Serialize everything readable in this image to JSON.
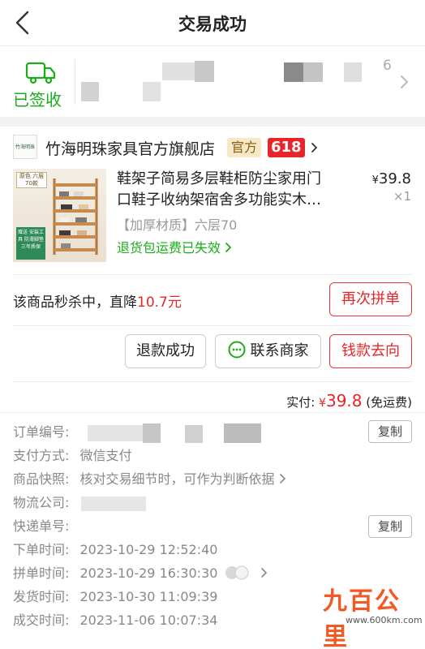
{
  "nav": {
    "title": "交易成功"
  },
  "logistics": {
    "status": "已签收",
    "digit": "6"
  },
  "shop": {
    "logo_text": "竹海明珠",
    "name": "竹海明珠家具官方旗舰店",
    "badge_official": "官方",
    "badge_618": "618"
  },
  "product": {
    "title_line1": "鞋架子简易多层鞋柜防尘家用门",
    "title_line2": "口鞋子收纳架宿舍多功能实木…",
    "price_symbol": "¥",
    "price": "39.8",
    "qty": "×1",
    "spec": "【加厚材质】六层70",
    "refund_note": "退货包运费已失效",
    "thumb_tag": "原色 六层70款",
    "thumb_gift": "赠送 安装工具 防滑脚垫 三年质保"
  },
  "flash": {
    "text": "该商品秒杀中，直降",
    "amount": "10.7元"
  },
  "buttons": {
    "regroup": "再次拼单",
    "refund_done": "退款成功",
    "contact": "联系商家",
    "money_flow": "钱款去向"
  },
  "payment": {
    "label": "实付:",
    "symbol": "¥",
    "amount": "39.8",
    "note": "(免运费)"
  },
  "order": {
    "order_no_label": "订单编号:",
    "pay_method_label": "支付方式:",
    "pay_method_value": "微信支付",
    "snapshot_label": "商品快照:",
    "snapshot_value": "核对交易细节时，可作为判断依据",
    "courier_label": "物流公司:",
    "tracking_label": "快递单号:",
    "order_time_label": "下单时间:",
    "order_time": "2023-10-29 12:52:40",
    "group_time_label": "拼单时间:",
    "group_time": "2023-10-29 16:30:30",
    "ship_time_label": "发货时间:",
    "ship_time": "2023-10-30 11:09:39",
    "deal_time_label": "成交时间:",
    "deal_time": "2023-11-06 10:07:34",
    "copy": "复制"
  },
  "watermark": {
    "text": "九百公里",
    "url": "www.600km.com"
  },
  "colors": {
    "green": "#1aad19",
    "red": "#e8262a"
  }
}
